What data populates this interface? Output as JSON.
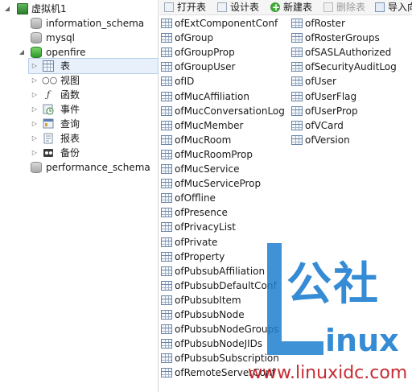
{
  "tree": {
    "connection": "虚拟机1",
    "databases": [
      "information_schema",
      "mysql"
    ],
    "open_db": "openfire",
    "children": [
      "表",
      "视图",
      "函数",
      "事件",
      "查询",
      "报表",
      "备份"
    ],
    "last_db": "performance_schema"
  },
  "toolbar": {
    "open_table": "打开表",
    "design_table": "设计表",
    "new_table": "新建表",
    "delete_table": "删除表",
    "import": "导入向"
  },
  "tables_col1": [
    "ofExtComponentConf",
    "ofGroup",
    "ofGroupProp",
    "ofGroupUser",
    "ofID",
    "ofMucAffiliation",
    "ofMucConversationLog",
    "ofMucMember",
    "ofMucRoom",
    "ofMucRoomProp",
    "ofMucService",
    "ofMucServiceProp",
    "ofOffline",
    "ofPresence",
    "ofPrivacyList",
    "ofPrivate",
    "ofProperty",
    "ofPubsubAffiliation",
    "ofPubsubDefaultConf",
    "ofPubsubItem",
    "ofPubsubNode",
    "ofPubsubNodeGroups",
    "ofPubsubNodeJIDs",
    "ofPubsubSubscription",
    "ofRemoteServerConf"
  ],
  "tables_col2": [
    "ofRoster",
    "ofRosterGroups",
    "ofSASLAuthorized",
    "ofSecurityAuditLog",
    "ofUser",
    "ofUserFlag",
    "ofUserProp",
    "ofVCard",
    "ofVersion"
  ],
  "watermark": {
    "mark_a": "公",
    "mark_b": "社",
    "mark_c": "inux",
    "url": "www.linuxidc.com"
  },
  "colors": {
    "accent": "#1e6cc8",
    "selection": "#e8f0fb",
    "watermark_blue": "#1f7fd0"
  },
  "icons": {
    "connection": "server-icon",
    "database": "database-icon",
    "table": "table-grid-icon",
    "view": "glasses-icon",
    "function": "function-icon",
    "event": "clock-icon",
    "query": "query-icon",
    "report": "report-icon",
    "backup": "backup-icon"
  }
}
